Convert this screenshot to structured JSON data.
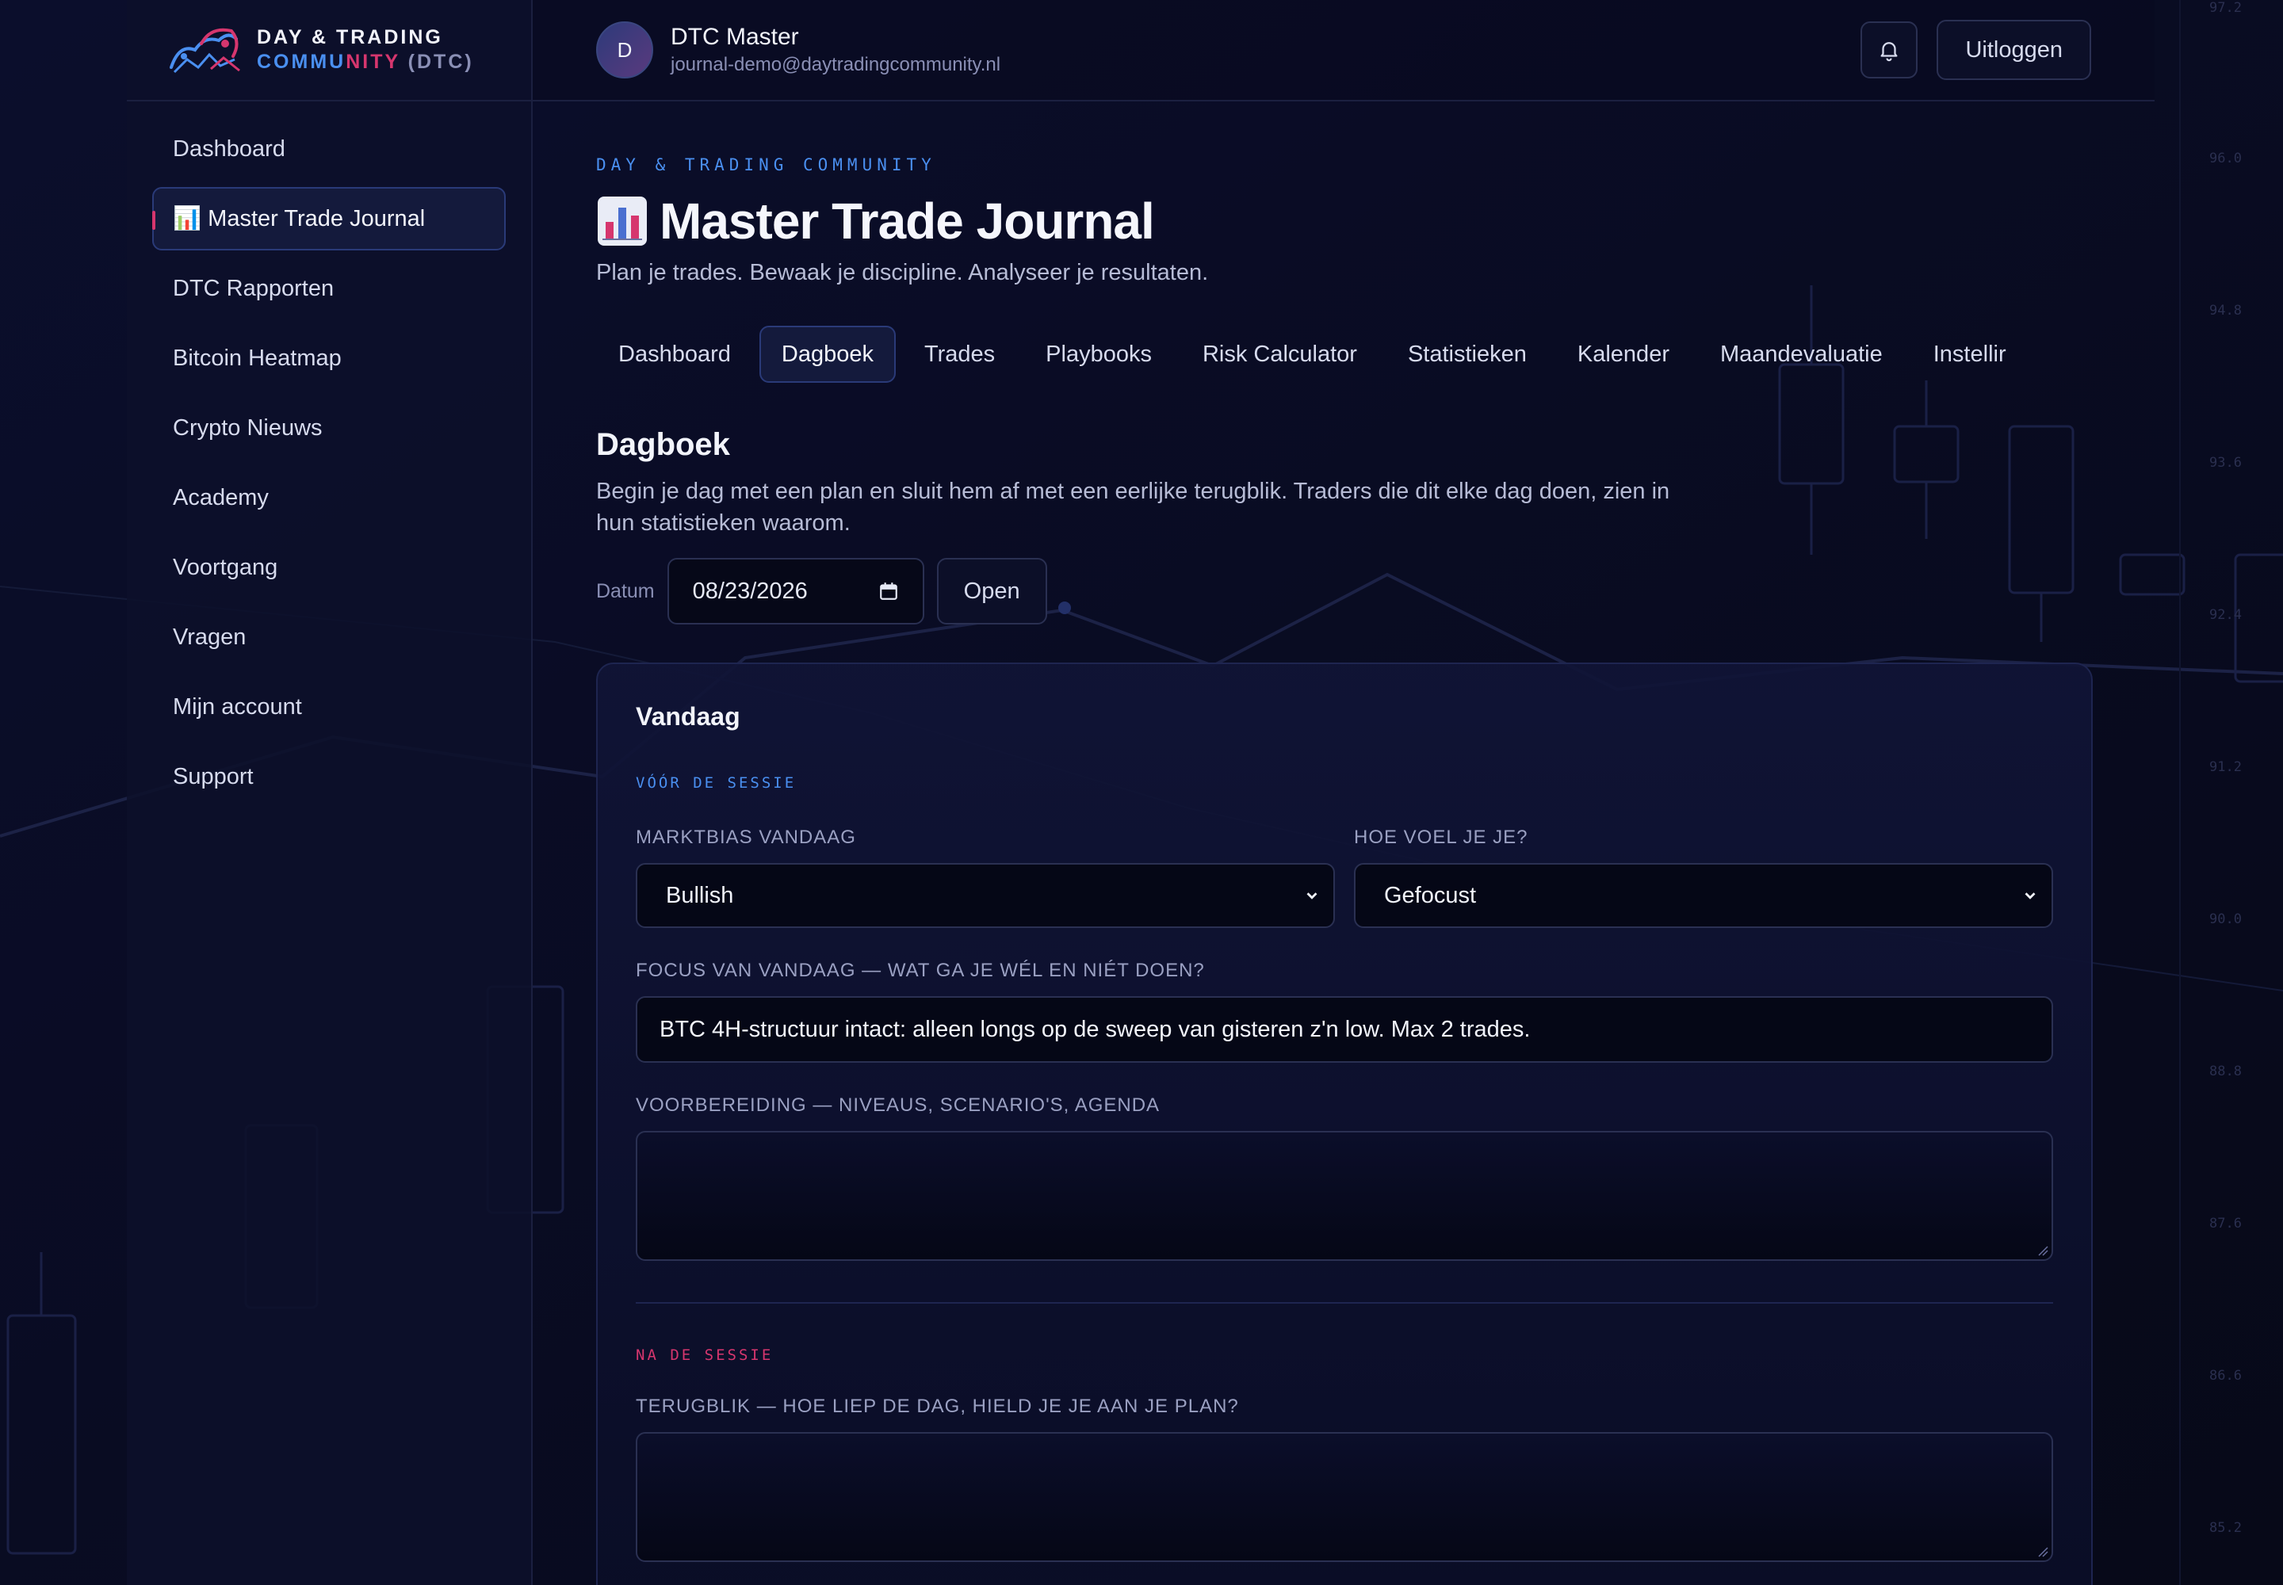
{
  "brand": {
    "line1": "DAY & TRADING",
    "line2_a": "COMMU",
    "line2_b": "NITY",
    "line2_c": " (DTC)"
  },
  "sidebar": {
    "items": [
      {
        "label": "Dashboard",
        "active": false
      },
      {
        "label": "📊 Master Trade Journal",
        "active": true
      },
      {
        "label": "DTC Rapporten",
        "active": false
      },
      {
        "label": "Bitcoin Heatmap",
        "active": false
      },
      {
        "label": "Crypto Nieuws",
        "active": false
      },
      {
        "label": "Academy",
        "active": false
      },
      {
        "label": "Voortgang",
        "active": false
      },
      {
        "label": "Vragen",
        "active": false
      },
      {
        "label": "Mijn account",
        "active": false
      },
      {
        "label": "Support",
        "active": false
      }
    ]
  },
  "user": {
    "initial": "D",
    "name": "DTC Master",
    "email": "journal-demo@daytradingcommunity.nl"
  },
  "header": {
    "bell_icon": "bell-icon",
    "logout_label": "Uitloggen"
  },
  "page": {
    "eyebrow": "DAY & TRADING COMMUNITY",
    "title": "Master Trade Journal",
    "subtitle": "Plan je trades. Bewaak je discipline. Analyseer je resultaten."
  },
  "tabs": [
    {
      "label": "Dashboard",
      "active": false
    },
    {
      "label": "Dagboek",
      "active": true
    },
    {
      "label": "Trades",
      "active": false
    },
    {
      "label": "Playbooks",
      "active": false
    },
    {
      "label": "Risk Calculator",
      "active": false
    },
    {
      "label": "Statistieken",
      "active": false
    },
    {
      "label": "Kalender",
      "active": false
    },
    {
      "label": "Maandevaluatie",
      "active": false
    },
    {
      "label": "Instellir",
      "active": false
    }
  ],
  "dagboek": {
    "title": "Dagboek",
    "description": "Begin je dag met een plan en sluit hem af met een eerlijke terugblik. Traders die dit elke dag doen, zien in hun statistieken waarom.",
    "date_label": "Datum",
    "date_value": "08/23/2026",
    "open_label": "Open"
  },
  "card": {
    "title": "Vandaag",
    "pre_label": "VÓÓR DE SESSIE",
    "bias_label": "MARKTBIAS VANDAAG",
    "bias_value": "Bullish",
    "mood_label": "HOE VOEL JE JE?",
    "mood_value": "Gefocust",
    "focus_label": "FOCUS VAN VANDAAG — WAT GA JE WÉL EN NIÉT DOEN?",
    "focus_value": "BTC 4H-structuur intact: alleen longs op de sweep van gisteren z'n low. Max 2 trades.",
    "prep_label": "VOORBEREIDING — NIVEAUS, SCENARIO'S, AGENDA",
    "prep_value": "",
    "post_label": "NA DE SESSIE",
    "review_label": "TERUGBLIK — HOE LIEP DE DAG, HIELD JE JE AAN JE PLAN?",
    "review_value": ""
  },
  "background": {
    "price_axis": [
      "97.2",
      "96.0",
      "94.8",
      "93.6",
      "92.4",
      "91.2",
      "90.0",
      "88.8",
      "87.6",
      "86.6",
      "85.2"
    ]
  },
  "colors": {
    "accent_blue": "#4a8ff0",
    "accent_pink": "#d6366e",
    "background": "#080a1f"
  }
}
